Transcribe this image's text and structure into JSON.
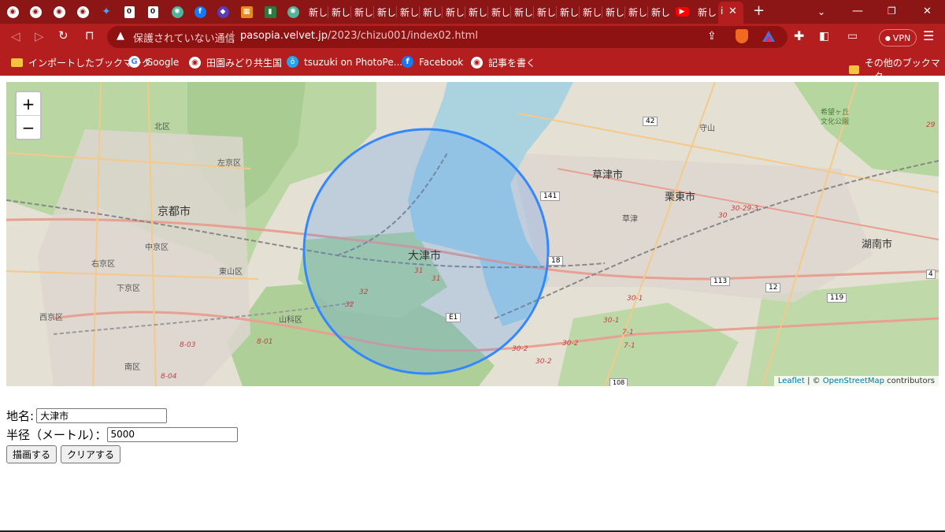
{
  "browser": {
    "new_tab_label": "新し",
    "active_tab_label": "i",
    "new_tab_button": "+",
    "omnibox": {
      "warning_text": "保護されていない通信",
      "url_host": "pasopia.velvet.jp",
      "url_path": "/2023/chizu001/index02.html"
    },
    "vpn_label": "VPN",
    "bookmarks": [
      {
        "label": "インポートしたブックマーク",
        "icon": "folder-icon"
      },
      {
        "label": "Google",
        "icon": "google-icon"
      },
      {
        "label": "田園みどり共生国",
        "icon": "globe-icon"
      },
      {
        "label": "tsuzuki on PhotoPe...",
        "icon": "tsuzuki-icon"
      },
      {
        "label": "Facebook",
        "icon": "facebook-icon"
      },
      {
        "label": "記事を書く",
        "icon": "globe-icon"
      }
    ],
    "other_bookmarks": "その他のブックマーク"
  },
  "map": {
    "zoom_in": "+",
    "zoom_out": "−",
    "attribution": {
      "leaflet": "Leaflet",
      "separator": " | © ",
      "osm": "OpenStreetMap",
      "suffix": " contributors"
    },
    "circle_color": "#3388ff",
    "labels": {
      "kita": "北区",
      "sakyo": "左京区",
      "kyoto": "京都市",
      "nakagyo": "中京区",
      "ukyo": "右京区",
      "shimogyo": "下京区",
      "higashiyama": "東山区",
      "nishikyo": "西京区",
      "yamashina": "山科区",
      "minami": "南区",
      "otsu": "大津市",
      "kusatsu_city": "草津市",
      "kusatsu": "草津",
      "ritto": "栗東市",
      "konan": "湖南市",
      "moriyama": "守山",
      "kibogaoka": "希望ヶ丘",
      "bunka": "文化公園",
      "r42": "42",
      "r141": "141",
      "r18": "18",
      "r113": "113",
      "r12": "12",
      "r119": "119",
      "e1": "E1",
      "n4": "4",
      "n29": "29",
      "n30": "30",
      "n30_29_3": "30-29-3",
      "n30_1": "30-1",
      "n30_1b": "30-1",
      "n7_1": "7-1",
      "n7_1b": "7-1",
      "n30_2": "30-2",
      "n30_2b": "30-2",
      "n30_2c": "30-2",
      "n31": "31",
      "n31b": "31",
      "n32": "32",
      "n32b": "32",
      "n8_01": "8-01",
      "n8_03": "8-03",
      "n8_04": "8-04",
      "n108": "108"
    }
  },
  "form": {
    "place_label": "地名:",
    "place_value": "大津市",
    "radius_label": "半径（メートル）：",
    "radius_value": "5000",
    "draw_button": "描画する",
    "clear_button": "クリアする"
  }
}
